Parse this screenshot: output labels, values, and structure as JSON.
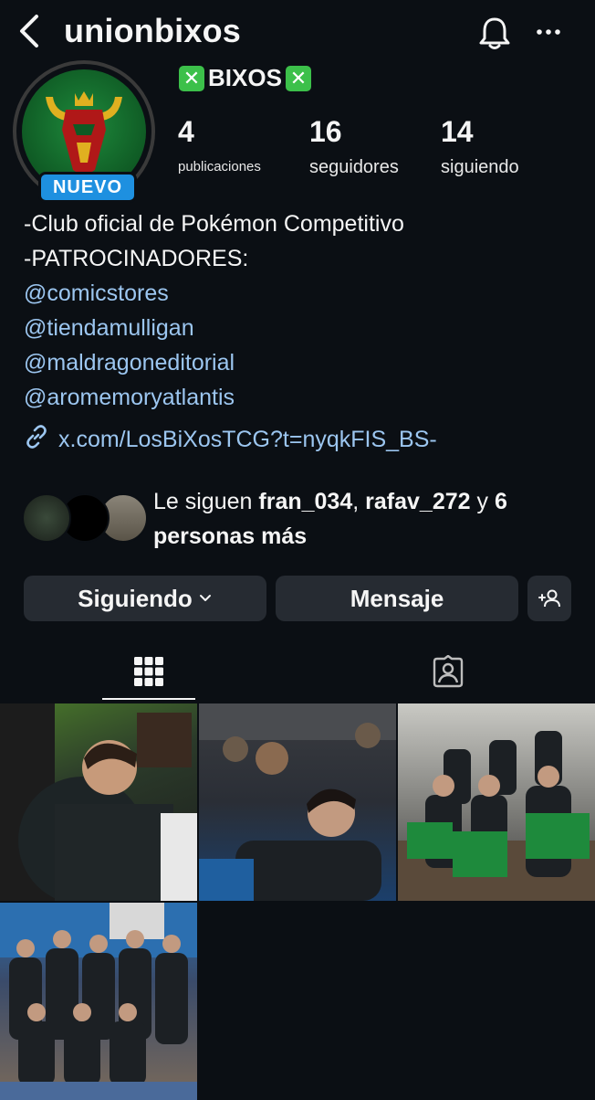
{
  "header": {
    "username": "unionbixos"
  },
  "profile": {
    "badge": "NUEVO",
    "display_name": "BIXOS",
    "stats": [
      {
        "value": "4",
        "label": "publicaciones"
      },
      {
        "value": "16",
        "label": "seguidores"
      },
      {
        "value": "14",
        "label": "siguiendo"
      }
    ],
    "bio": {
      "line1": "-Club oficial de Pokémon Competitivo",
      "line2": "-PATROCINADORES:",
      "mentions": [
        "@comicstores",
        "@tiendamulligan",
        "@maldragoneditorial",
        "@aromemoryatlantis"
      ]
    },
    "link": "x.com/LosBiXosTCG?t=nyqkFIS_BS-"
  },
  "followed_by": {
    "prefix": "Le siguen",
    "user1": "fran_034",
    "sep": ",",
    "user2": "rafav_272",
    "and": "y",
    "more": "6 personas más"
  },
  "actions": {
    "following": "Siguiendo",
    "message": "Mensaje"
  },
  "colors": {
    "background": "#0b0f14",
    "button": "#262b32",
    "link": "#9cc6f0",
    "badge": "#1e90e0",
    "x_box": "#3cc04a"
  },
  "icons": [
    "back-arrow-icon",
    "bell-icon",
    "more-icon",
    "x-mark-icon",
    "link-icon",
    "chevron-down-icon",
    "add-person-icon",
    "grid-icon",
    "tagged-icon"
  ]
}
